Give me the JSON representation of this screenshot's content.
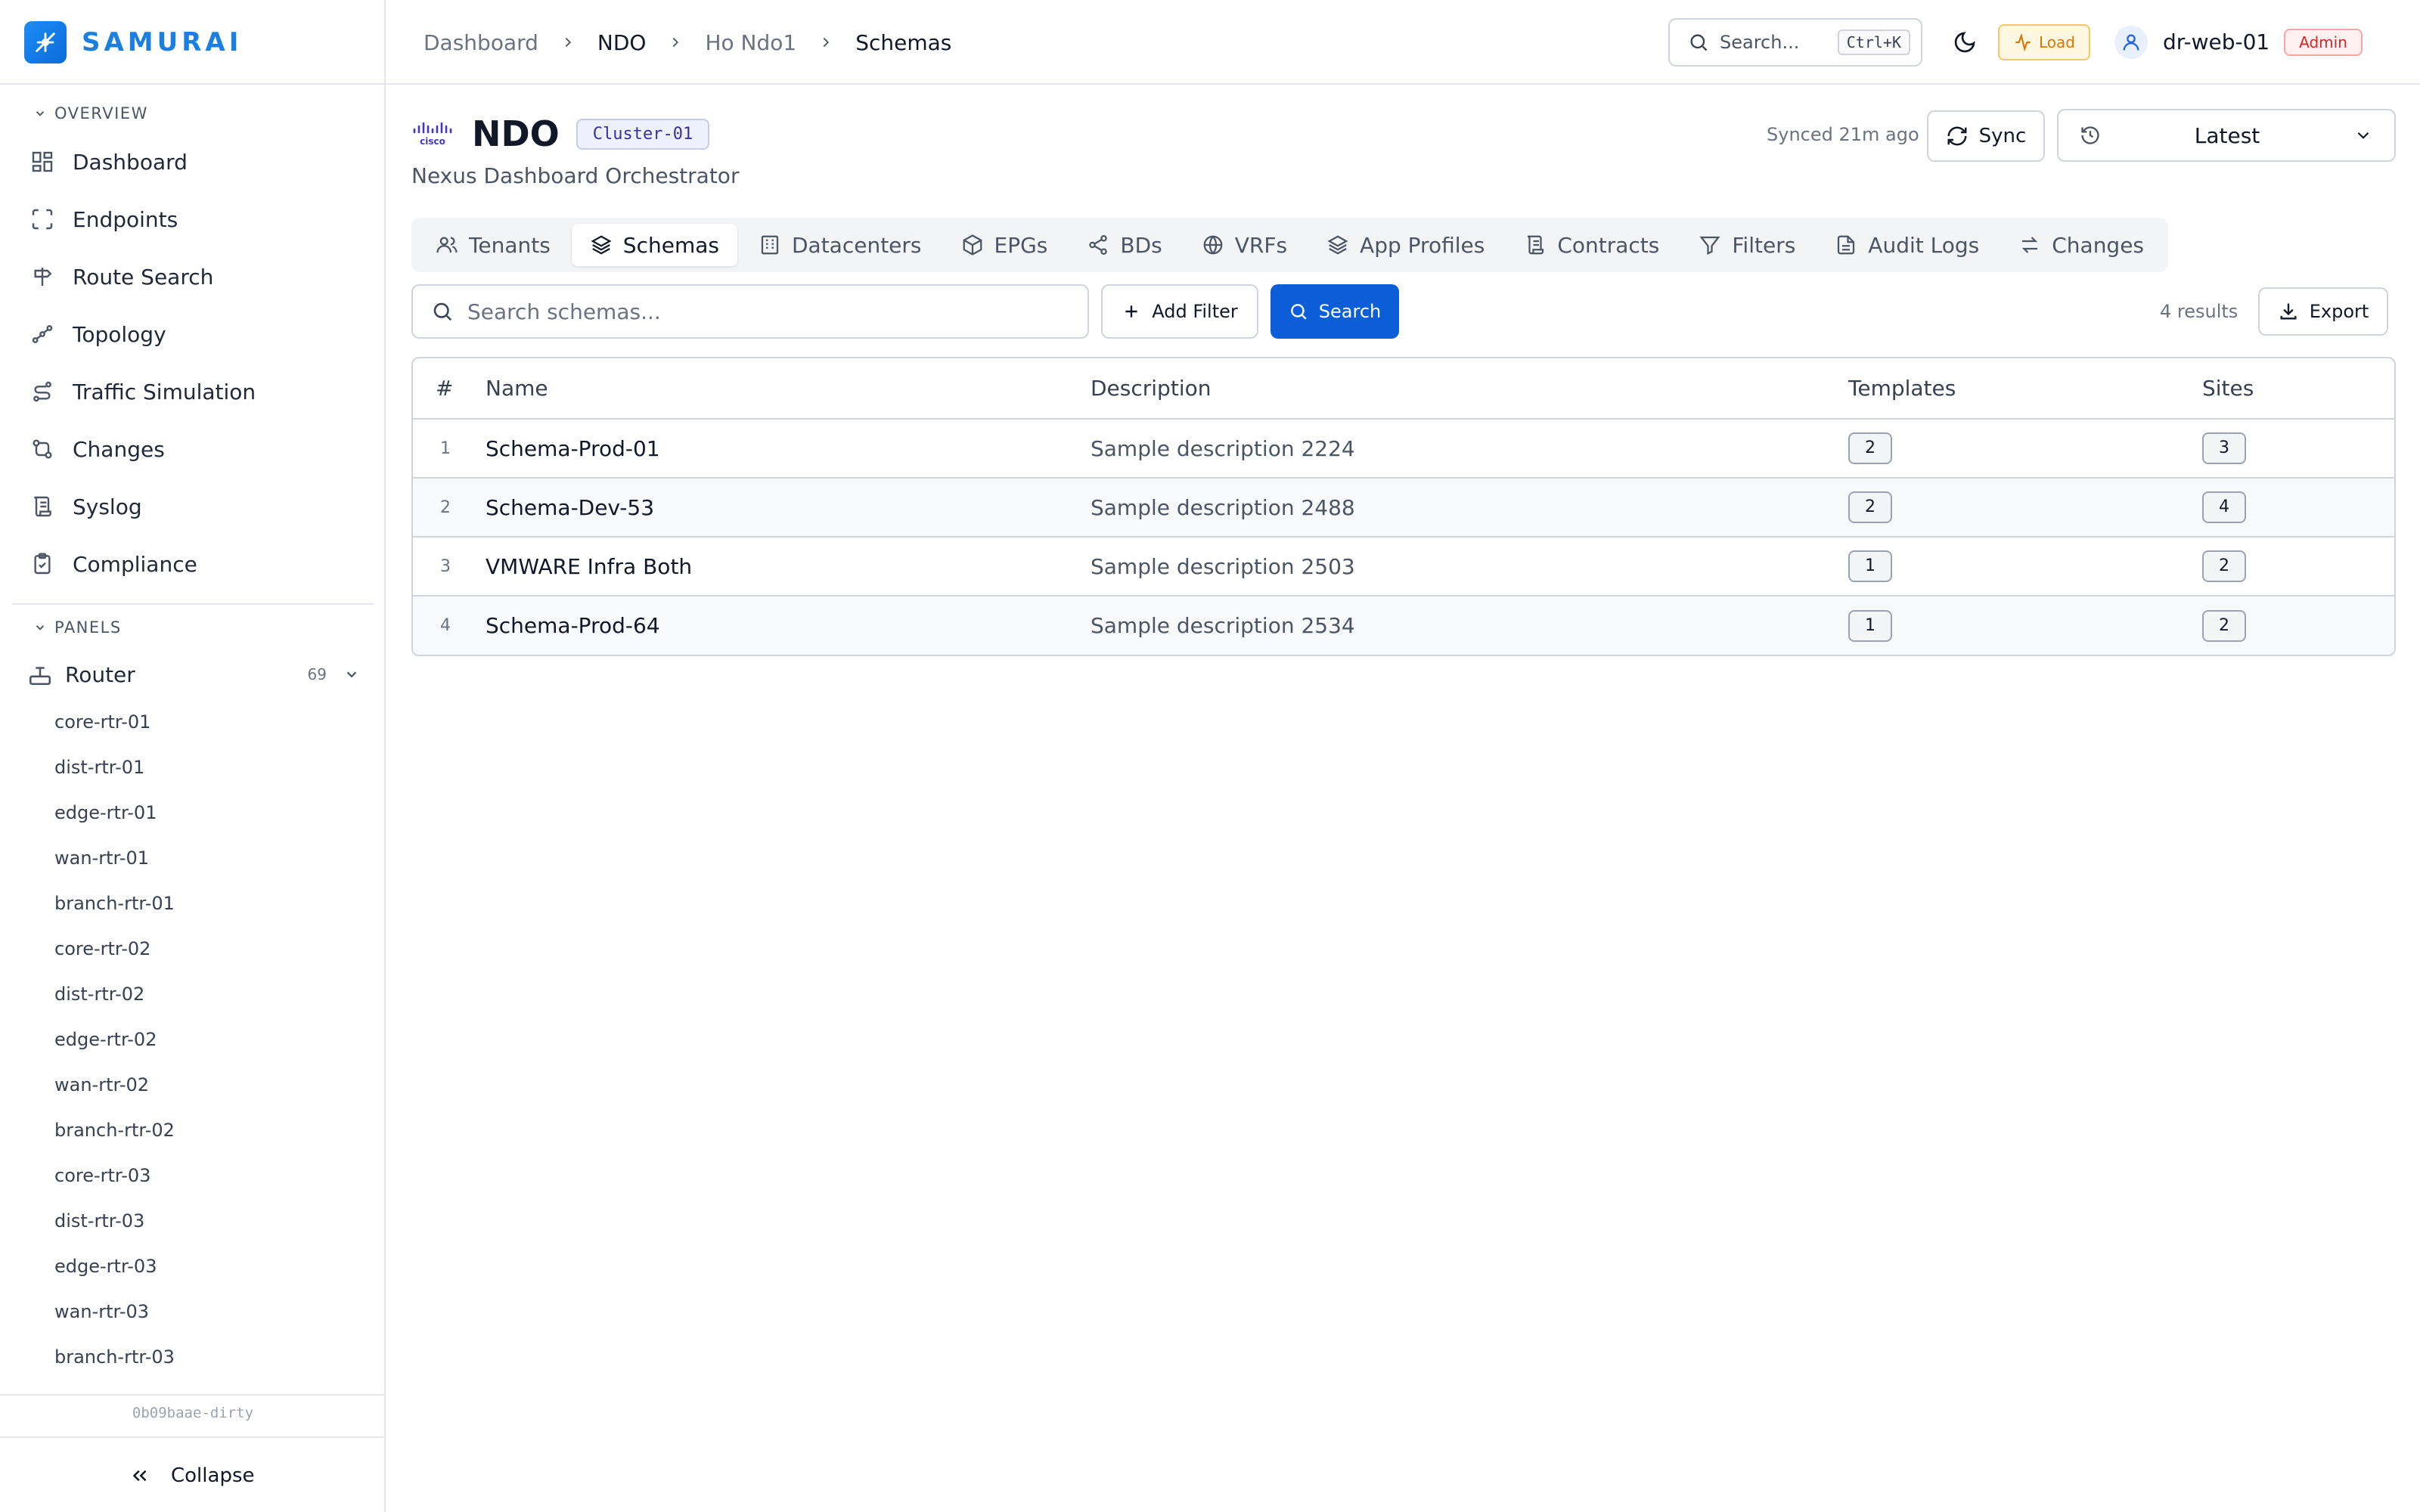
{
  "brand": {
    "name": "SAMURAI"
  },
  "sidebar": {
    "overview_label": "OVERVIEW",
    "items": [
      {
        "label": "Dashboard",
        "icon": "grid-icon"
      },
      {
        "label": "Endpoints",
        "icon": "scan-icon"
      },
      {
        "label": "Route Search",
        "icon": "signpost-icon"
      },
      {
        "label": "Topology",
        "icon": "topology-icon"
      },
      {
        "label": "Traffic Simulation",
        "icon": "route-icon"
      },
      {
        "label": "Changes",
        "icon": "git-compare-icon"
      },
      {
        "label": "Syslog",
        "icon": "scroll-icon"
      },
      {
        "label": "Compliance",
        "icon": "clipboard-check-icon"
      }
    ],
    "panels_label": "PANELS",
    "router": {
      "label": "Router",
      "count": "69"
    },
    "routers": [
      "core-rtr-01",
      "dist-rtr-01",
      "edge-rtr-01",
      "wan-rtr-01",
      "branch-rtr-01",
      "core-rtr-02",
      "dist-rtr-02",
      "edge-rtr-02",
      "wan-rtr-02",
      "branch-rtr-02",
      "core-rtr-03",
      "dist-rtr-03",
      "edge-rtr-03",
      "wan-rtr-03",
      "branch-rtr-03"
    ],
    "version": "0b09baae-dirty",
    "collapse_label": "Collapse"
  },
  "topbar": {
    "breadcrumbs": [
      "Dashboard",
      "NDO",
      "Ho Ndo1",
      "Schemas"
    ],
    "search_placeholder": "Search...",
    "shortcut": "Ctrl+K",
    "load_label": "Load",
    "user": "dr-web-01",
    "role": "Admin"
  },
  "page": {
    "title": "NDO",
    "cluster": "Cluster-01",
    "subtitle": "Nexus Dashboard Orchestrator",
    "synced": "Synced 21m ago",
    "sync_label": "Sync",
    "version": "Latest"
  },
  "tabs": [
    {
      "label": "Tenants",
      "icon": "users-icon"
    },
    {
      "label": "Schemas",
      "icon": "layers-icon",
      "active": true
    },
    {
      "label": "Datacenters",
      "icon": "building-icon"
    },
    {
      "label": "EPGs",
      "icon": "box-icon"
    },
    {
      "label": "BDs",
      "icon": "share-icon"
    },
    {
      "label": "VRFs",
      "icon": "globe-icon"
    },
    {
      "label": "App Profiles",
      "icon": "layers-icon"
    },
    {
      "label": "Contracts",
      "icon": "scroll-icon"
    },
    {
      "label": "Filters",
      "icon": "filter-icon"
    },
    {
      "label": "Audit Logs",
      "icon": "file-text-icon"
    },
    {
      "label": "Changes",
      "icon": "arrows-icon"
    }
  ],
  "toolbar": {
    "search_placeholder": "Search schemas...",
    "add_filter": "Add Filter",
    "search": "Search",
    "results": "4 results",
    "export": "Export"
  },
  "table": {
    "columns": [
      "#",
      "Name",
      "Description",
      "Templates",
      "Sites"
    ],
    "rows": [
      {
        "idx": "1",
        "name": "Schema-Prod-01",
        "desc": "Sample description 2224",
        "templates": "2",
        "sites": "3"
      },
      {
        "idx": "2",
        "name": "Schema-Dev-53",
        "desc": "Sample description 2488",
        "templates": "2",
        "sites": "4"
      },
      {
        "idx": "3",
        "name": "VMWARE Infra Both",
        "desc": "Sample description 2503",
        "templates": "1",
        "sites": "2"
      },
      {
        "idx": "4",
        "name": "Schema-Prod-64",
        "desc": "Sample description 2534",
        "templates": "1",
        "sites": "2"
      }
    ]
  },
  "colors": {
    "accent": "#0b5ed7",
    "brand": "#1a7fe0",
    "load": "#d97706",
    "admin": "#dc2626"
  }
}
